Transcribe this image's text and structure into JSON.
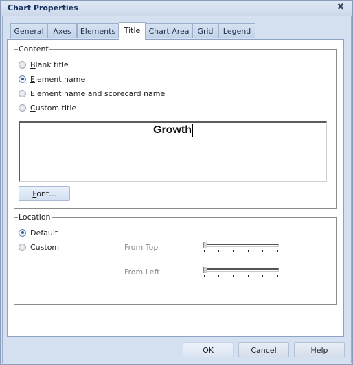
{
  "window": {
    "title": "Chart Properties",
    "close_icon": "close-icon"
  },
  "tabs": [
    {
      "label": "General",
      "active": false
    },
    {
      "label": "Axes",
      "active": false
    },
    {
      "label": "Elements",
      "active": false
    },
    {
      "label": "Title",
      "active": true
    },
    {
      "label": "Chart Area",
      "active": false
    },
    {
      "label": "Grid",
      "active": false
    },
    {
      "label": "Legend",
      "active": false
    }
  ],
  "content": {
    "group_label": "Content",
    "options": [
      {
        "label": "Blank title",
        "mnemonic": "B",
        "checked": false
      },
      {
        "label": "Element name",
        "mnemonic": "E",
        "checked": true
      },
      {
        "label": "Element name and scorecard name",
        "mnemonic": "s",
        "checked": false
      },
      {
        "label": "Custom title",
        "mnemonic": "C",
        "checked": false
      }
    ],
    "title_text": "Growth",
    "font_button": "Font..."
  },
  "location": {
    "group_label": "Location",
    "options": [
      {
        "label": "Default",
        "checked": true
      },
      {
        "label": "Custom",
        "checked": false
      }
    ],
    "from_top_label": "From Top",
    "from_left_label": "From Left",
    "from_top_value": 0,
    "from_left_value": 0,
    "disabled": true
  },
  "footer": {
    "ok": "OK",
    "cancel": "Cancel",
    "help": "Help"
  }
}
